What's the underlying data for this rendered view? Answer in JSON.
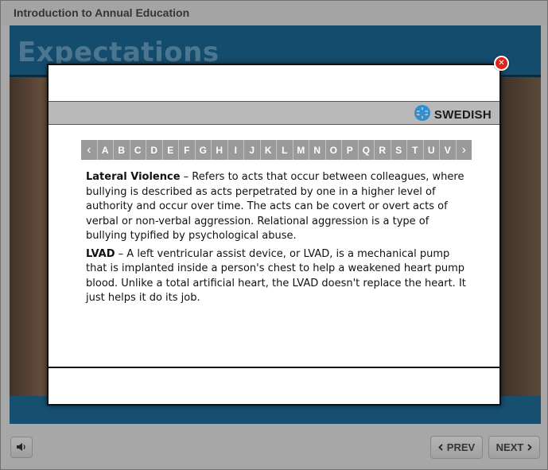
{
  "course": {
    "title": "Introduction to Annual Education",
    "slide_heading": "Expectations"
  },
  "controls": {
    "prev_label": "PREV",
    "next_label": "NEXT",
    "audio_icon": "speaker-icon"
  },
  "modal": {
    "close_icon": "close-icon",
    "brand_name": "SWEDISH",
    "brand_color": "#2f8fd0",
    "alphabet": {
      "prev_arrow": "‹",
      "next_arrow": "›",
      "letters": [
        "A",
        "B",
        "C",
        "D",
        "E",
        "F",
        "G",
        "H",
        "I",
        "J",
        "K",
        "L",
        "M",
        "N",
        "O",
        "P",
        "Q",
        "R",
        "S",
        "T",
        "U",
        "V"
      ]
    },
    "entries": [
      {
        "term": "Lateral Violence",
        "definition": " – Refers to acts that occur between colleagues, where bullying is described as acts perpetrated by one in a higher level of authority and occur over time. The acts can be covert or overt acts of verbal or non-verbal aggression. Relational aggression is a type of bullying typified by psychological abuse."
      },
      {
        "term": "LVAD",
        "definition": " – A left ventricular assist device, or LVAD, is a mechanical pump that is implanted inside a person's chest to help a weakened heart pump blood. Unlike a total artificial heart, the LVAD doesn't replace the heart. It just helps it do its job."
      }
    ]
  },
  "colors": {
    "slide_blue": "#1f6e9c",
    "close_red": "#e2231a",
    "alphabet_gray": "#9a9a9a"
  }
}
